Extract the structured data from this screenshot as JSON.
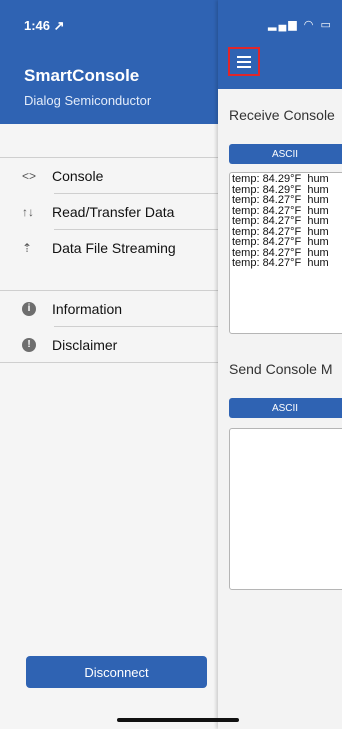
{
  "status": {
    "time": "1:46 ↗"
  },
  "drawer": {
    "title": "SmartConsole",
    "subtitle": "Dialog Semiconductor",
    "items": [
      {
        "label": "Console",
        "icon": "code-icon",
        "glyph": "<>"
      },
      {
        "label": "Read/Transfer Data",
        "icon": "transfer-arrows-icon",
        "glyph": "↑↓"
      },
      {
        "label": "Data File Streaming",
        "icon": "upload-icon",
        "glyph": "⇡"
      }
    ],
    "info_items": [
      {
        "label": "Information",
        "icon": "info-icon",
        "glyph": "i"
      },
      {
        "label": "Disclaimer",
        "icon": "alert-icon",
        "glyph": "!"
      }
    ],
    "disconnect_label": "Disconnect"
  },
  "panel": {
    "receive_title": "Receive Console",
    "receive_format": "ASCII",
    "console_lines": [
      "temp: 84.29°F  hum",
      "temp: 84.29°F  hum",
      "temp: 84.27°F  hum",
      "temp: 84.27°F  hum",
      "temp: 84.27°F  hum",
      "temp: 84.27°F  hum",
      "temp: 84.27°F  hum",
      "temp: 84.27°F  hum",
      "temp: 84.27°F  hum"
    ],
    "send_title": "Send Console M",
    "send_format": "ASCII"
  },
  "colors": {
    "brand": "#2f63b3",
    "highlight": "#e0262a"
  }
}
